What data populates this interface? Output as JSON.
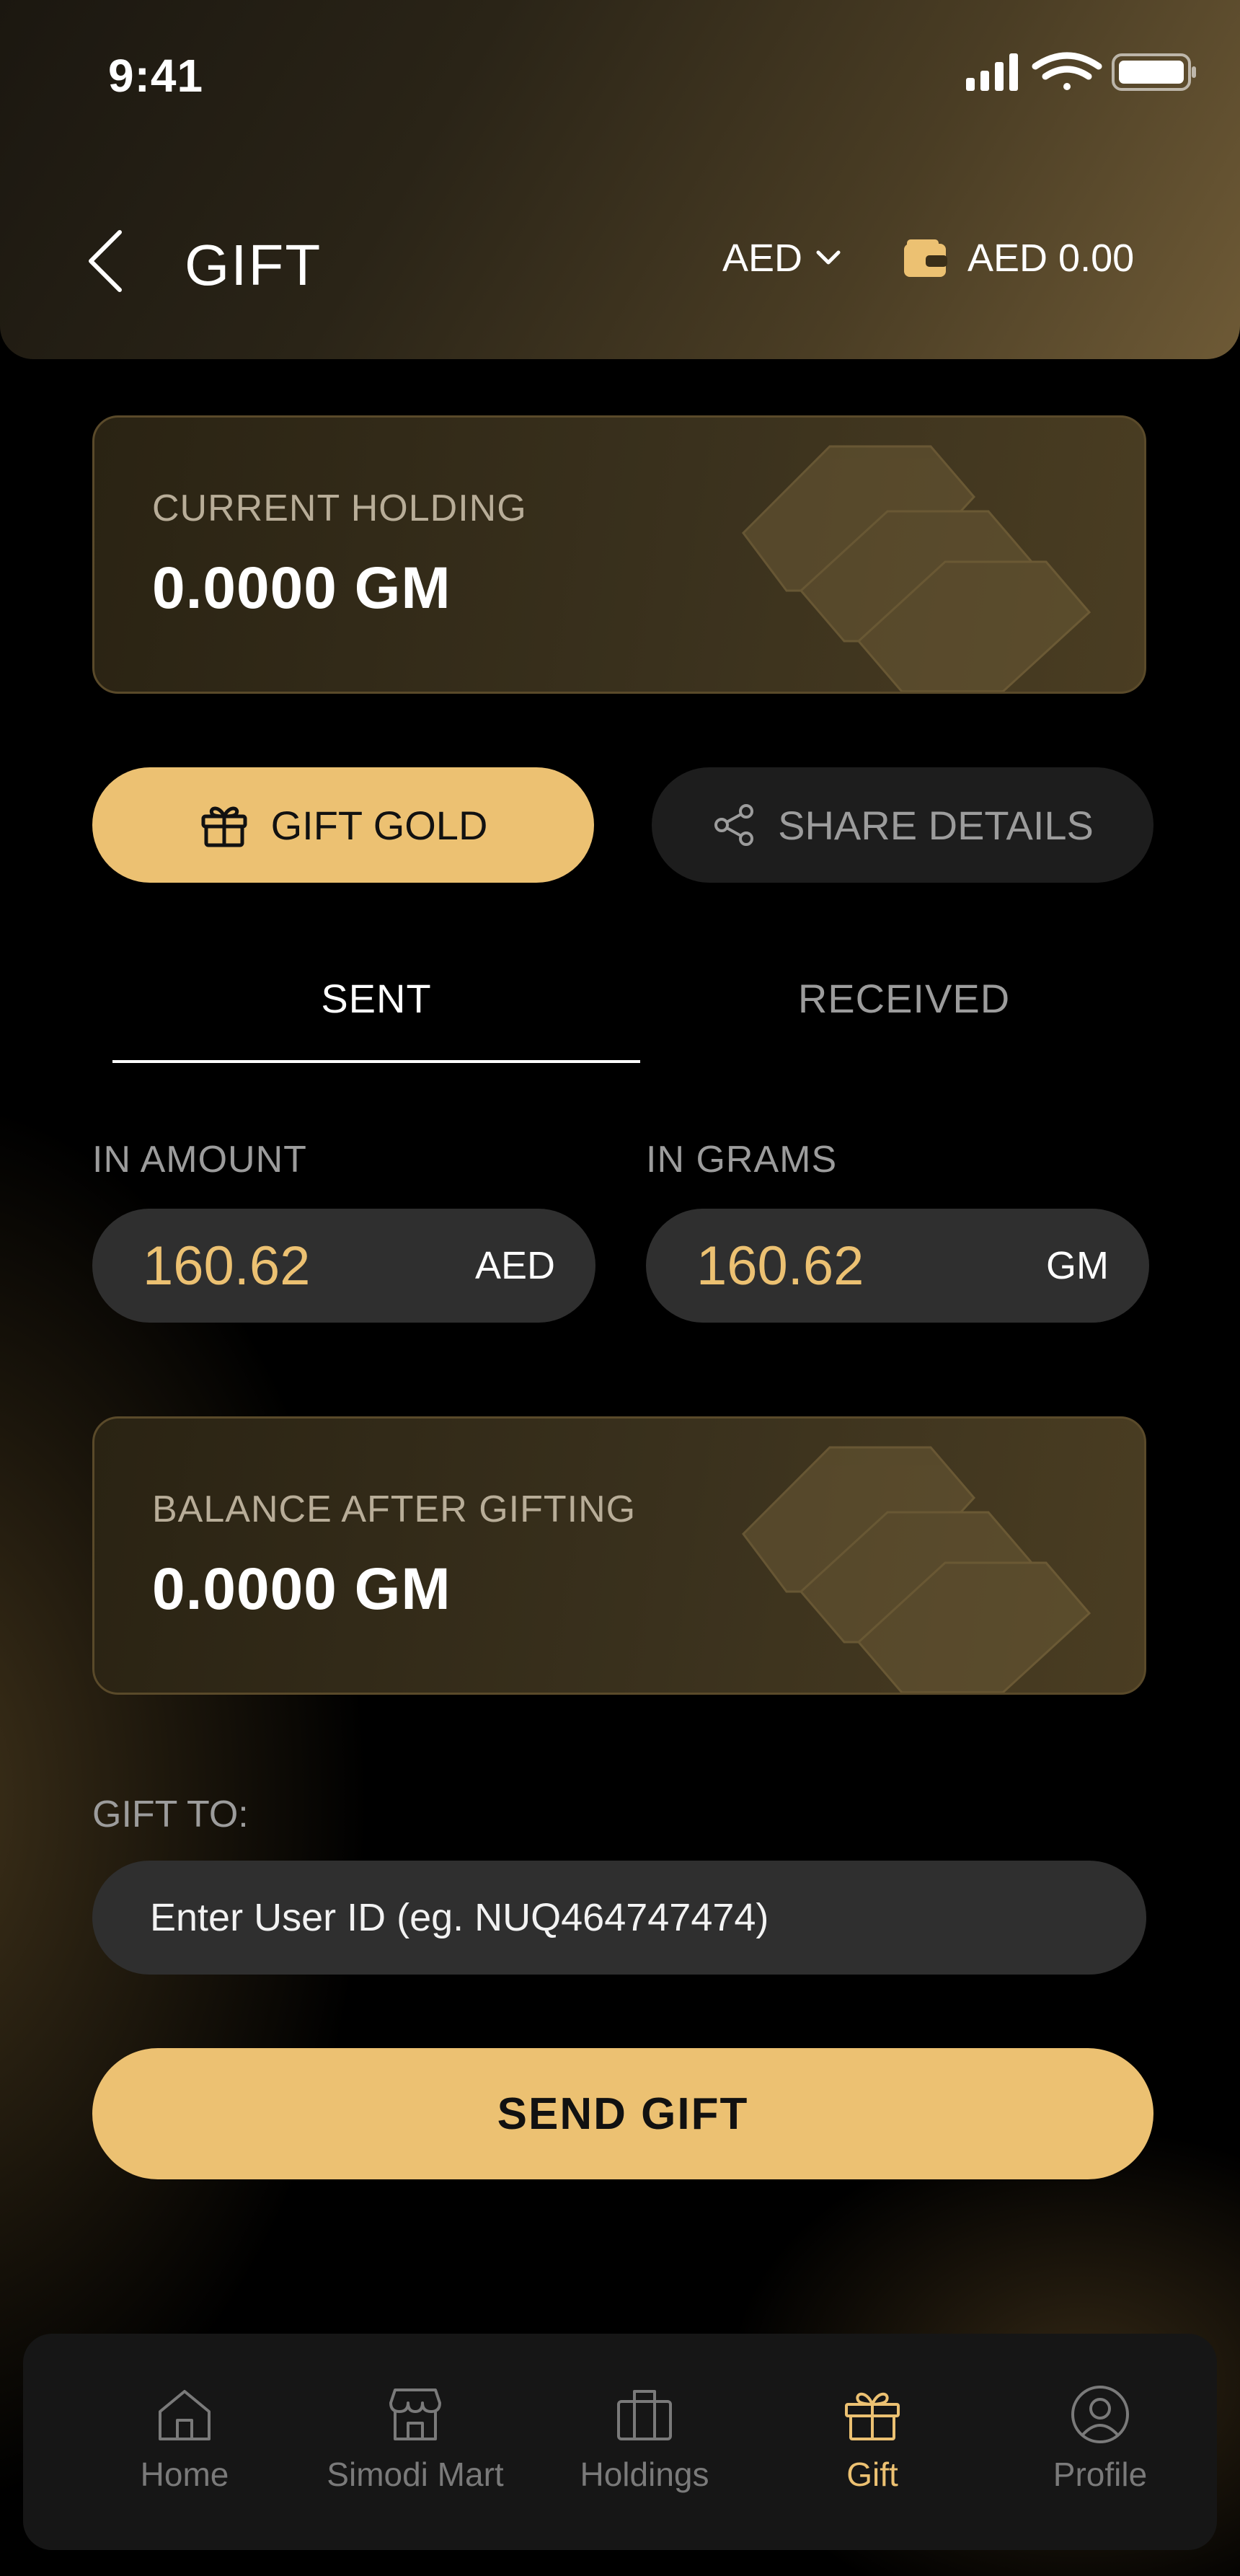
{
  "status_bar": {
    "time": "9:41"
  },
  "header": {
    "title": "GIFT",
    "currency": "AED",
    "wallet_balance": "AED 0.00"
  },
  "current_holding": {
    "label": "CURRENT HOLDING",
    "value": "0.0000 GM"
  },
  "actions": {
    "gift_gold": "GIFT GOLD",
    "share_details": "SHARE DETAILS"
  },
  "tabs": [
    {
      "label": "SENT",
      "active": true
    },
    {
      "label": "RECEIVED",
      "active": false
    }
  ],
  "amount": {
    "in_amount_label": "IN AMOUNT",
    "in_amount_value": "160.62",
    "in_amount_unit": "AED",
    "in_grams_label": "IN GRAMS",
    "in_grams_value": "160.62",
    "in_grams_unit": "GM"
  },
  "balance_after": {
    "label": "BALANCE AFTER GIFTING",
    "value": "0.0000 GM"
  },
  "gift_to": {
    "label": "GIFT TO:",
    "placeholder": "Enter User ID (eg. NUQ464747474)"
  },
  "send_button": "SEND GIFT",
  "nav": [
    {
      "label": "Home",
      "icon": "home-icon"
    },
    {
      "label": "Simodi Mart",
      "icon": "store-icon"
    },
    {
      "label": "Holdings",
      "icon": "holdings-icon"
    },
    {
      "label": "Gift",
      "icon": "gift-icon",
      "active": true
    },
    {
      "label": "Profile",
      "icon": "profile-icon"
    }
  ],
  "colors": {
    "accent": "#ecc172",
    "pill": "#2f2f2f",
    "muted": "#9c9c9c"
  }
}
